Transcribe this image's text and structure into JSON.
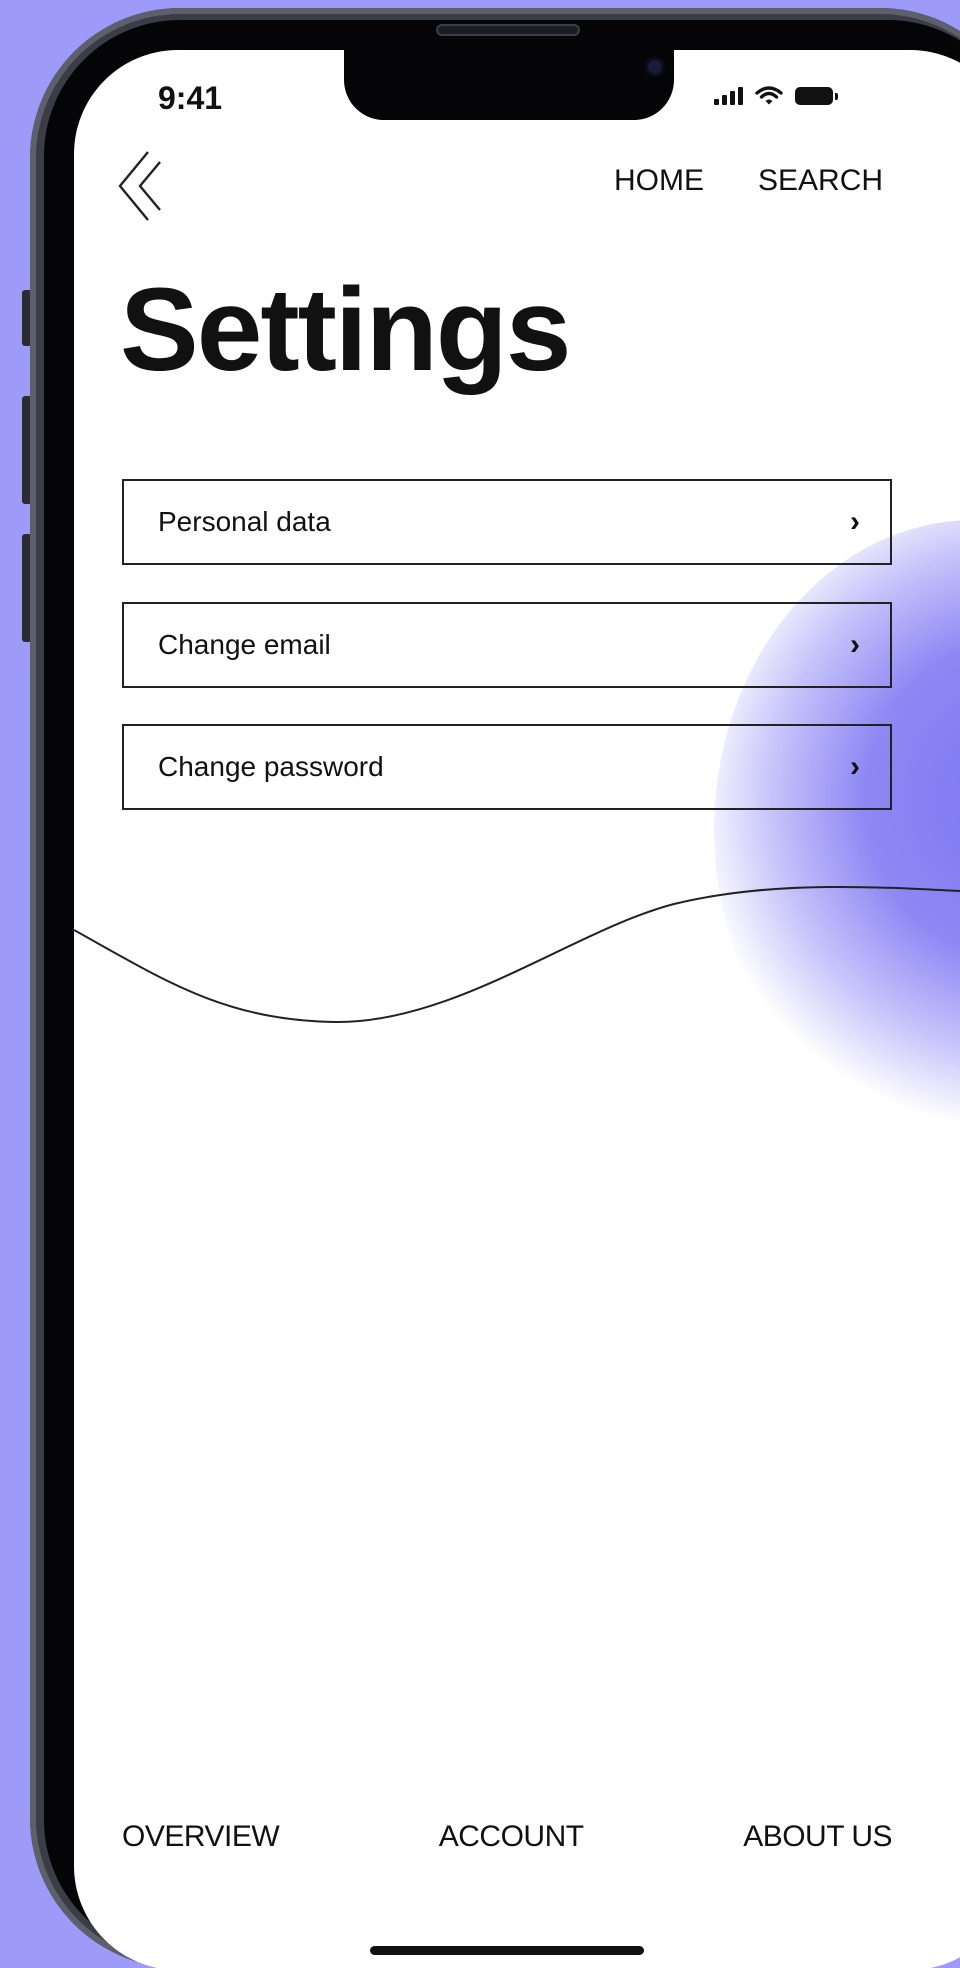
{
  "status_bar": {
    "time": "9:41"
  },
  "header": {
    "back_icon": "chevron-left-icon",
    "nav": [
      "HOME",
      "SEARCH"
    ]
  },
  "page": {
    "title": "Settings"
  },
  "settings_items": [
    {
      "label": "Personal data",
      "icon": "chevron-right-icon"
    },
    {
      "label": "Change email",
      "icon": "chevron-right-icon"
    },
    {
      "label": "Change password",
      "icon": "chevron-right-icon"
    }
  ],
  "bottom_nav": [
    "OVERVIEW",
    "ACCOUNT",
    "ABOUT US"
  ],
  "colors": {
    "background": "#9e9af7",
    "accent_glow": "#7b74f2",
    "text": "#111111",
    "screen": "#ffffff"
  }
}
